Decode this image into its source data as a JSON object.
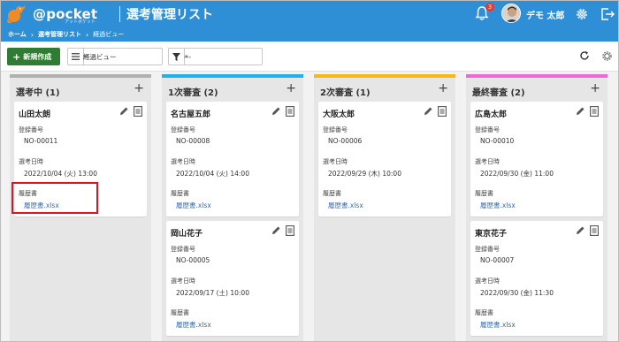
{
  "header": {
    "logo_text": "@pocket",
    "logo_sub": "アットポケット",
    "app_title": "選考管理リスト",
    "notification_count": "3",
    "user_name": "デモ 太郎"
  },
  "breadcrumb": [
    "ホーム",
    "選考管理リスト",
    "経過ビュー"
  ],
  "toolbar": {
    "new_label": "新規作成",
    "view_select": "経過ビュー",
    "filter_select": "---"
  },
  "columns": [
    {
      "title": "選考中 (1)",
      "color": "#b0b0b0",
      "cards": [
        {
          "name": "山田太朗",
          "reg_label": "登録番号",
          "reg_no": "NO-00011",
          "date_label": "選考日時",
          "date": "2022/10/04 (火) 13:00",
          "resume_label": "履歴書",
          "resume_file": "履歴書.xlsx"
        }
      ]
    },
    {
      "title": "1次審査 (2)",
      "color": "#22b0e8",
      "cards": [
        {
          "name": "名古屋五郎",
          "reg_label": "登録番号",
          "reg_no": "NO-00008",
          "date_label": "選考日時",
          "date": "2022/10/04 (火) 14:00",
          "resume_label": "履歴書",
          "resume_file": "履歴書.xlsx"
        },
        {
          "name": "岡山花子",
          "reg_label": "登録番号",
          "reg_no": "NO-00005",
          "date_label": "選考日時",
          "date": "2022/09/17 (土) 10:00",
          "resume_label": "履歴書",
          "resume_file": "履歴書.xlsx"
        }
      ]
    },
    {
      "title": "2次審査 (1)",
      "color": "#f5b814",
      "cards": [
        {
          "name": "大阪太郎",
          "reg_label": "登録番号",
          "reg_no": "NO-00006",
          "date_label": "選考日時",
          "date": "2022/09/29 (木) 10:00",
          "resume_label": "履歴書",
          "resume_file": "履歴書.xlsx"
        }
      ]
    },
    {
      "title": "最終審査 (2)",
      "color": "#ec6ad8",
      "cards": [
        {
          "name": "広島太郎",
          "reg_label": "登録番号",
          "reg_no": "NO-00010",
          "date_label": "選考日時",
          "date": "2022/09/30 (金) 11:00",
          "resume_label": "履歴書",
          "resume_file": "履歴書.xlsx"
        },
        {
          "name": "東京花子",
          "reg_label": "登録番号",
          "reg_no": "NO-00007",
          "date_label": "選考日時",
          "date": "2022/09/30 (金) 11:30",
          "resume_label": "履歴書",
          "resume_file": "履歴書.xlsx"
        }
      ]
    }
  ]
}
